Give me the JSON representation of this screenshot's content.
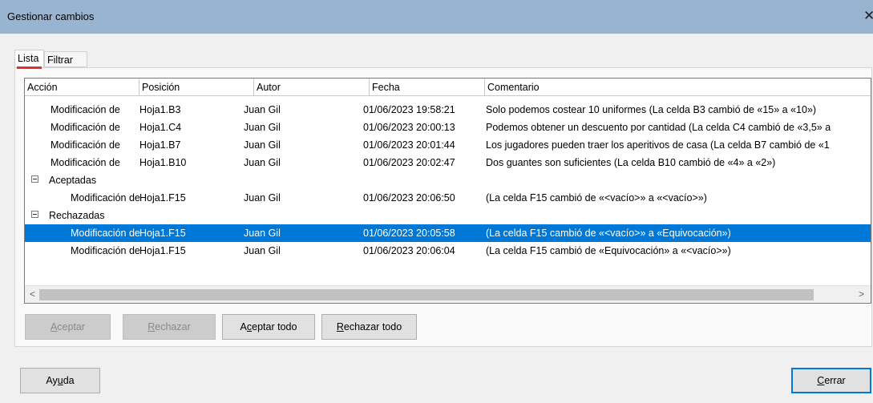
{
  "window": {
    "title": "Gestionar cambios",
    "close_glyph": "✕"
  },
  "tabs": [
    {
      "label": "Lista"
    },
    {
      "label": "Filtrar"
    }
  ],
  "columns": [
    "Acción",
    "Posición",
    "Autor",
    "Fecha",
    "Comentario"
  ],
  "rows": [
    {
      "accion": "Modificación de",
      "posicion": "Hoja1.B3",
      "autor": "Juan Gil",
      "fecha": "01/06/2023 19:58:21",
      "comentario": "Solo podemos costear 10 uniformes (La celda B3 cambió de «15» a «10»)"
    },
    {
      "accion": "Modificación de",
      "posicion": "Hoja1.C4",
      "autor": "Juan Gil",
      "fecha": "01/06/2023 20:00:13",
      "comentario": "Podemos obtener un descuento por cantidad (La celda C4 cambió de «3,5» a"
    },
    {
      "accion": "Modificación de",
      "posicion": "Hoja1.B7",
      "autor": "Juan Gil",
      "fecha": "01/06/2023 20:01:44",
      "comentario": "Los jugadores pueden traer los aperitivos de casa (La celda B7 cambió de «1"
    },
    {
      "accion": "Modificación de",
      "posicion": "Hoja1.B10",
      "autor": "Juan Gil",
      "fecha": "01/06/2023 20:02:47",
      "comentario": "Dos guantes son suficientes (La celda B10 cambió de «4» a «2»)"
    }
  ],
  "groups": {
    "accepted": {
      "label": "Aceptadas",
      "rows": [
        {
          "accion": "Modificación de",
          "posicion": "Hoja1.F15",
          "autor": "Juan Gil",
          "fecha": "01/06/2023 20:06:50",
          "comentario": " (La celda F15 cambió de «<vacío>» a «<vacío>»)"
        }
      ]
    },
    "rejected": {
      "label": "Rechazadas",
      "rows": [
        {
          "accion": "Modificación de",
          "posicion": "Hoja1.F15",
          "autor": "Juan Gil",
          "fecha": "01/06/2023 20:05:58",
          "comentario": " (La celda F15 cambió de «<vacío>» a «Equivocación»)"
        },
        {
          "accion": "Modificación de",
          "posicion": "Hoja1.F15",
          "autor": "Juan Gil",
          "fecha": "01/06/2023 20:06:04",
          "comentario": " (La celda F15 cambió de «Equivocación» a «<vacío>»)"
        }
      ]
    }
  },
  "scroll": {
    "left": "<",
    "right": ">"
  },
  "buttons": {
    "accept": {
      "u": "A",
      "rest": "ceptar"
    },
    "reject": {
      "u": "R",
      "rest": "echazar"
    },
    "accept_all": {
      "pre": "A",
      "u": "c",
      "rest": "eptar todo"
    },
    "reject_all": {
      "u": "R",
      "rest": "echazar todo"
    },
    "help": {
      "pre": "Ay",
      "u": "u",
      "rest": "da"
    },
    "close": {
      "u": "C",
      "rest": "errar"
    }
  },
  "colors": {
    "titlebar": "#99b4d1",
    "selection": "#0078d7",
    "tab_indicator": "#e03030"
  }
}
